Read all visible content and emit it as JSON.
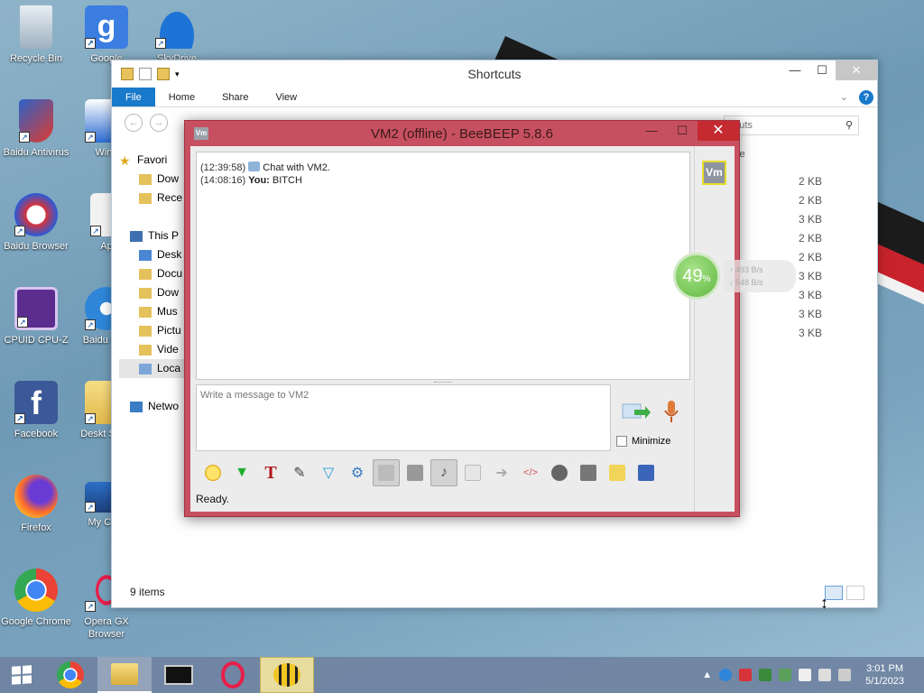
{
  "desktop": {
    "icons": [
      {
        "label": "Recycle Bin"
      },
      {
        "label": "Google"
      },
      {
        "label": "SkyDrive"
      },
      {
        "label": "Baidu Antivirus"
      },
      {
        "label": "WinL"
      },
      {
        "label": "Baidu Browser"
      },
      {
        "label": "Ap"
      },
      {
        "label": "CPUID CPU-Z"
      },
      {
        "label": "Baidu Fast"
      },
      {
        "label": "Facebook"
      },
      {
        "label": "Deskt Short"
      },
      {
        "label": "Firefox"
      },
      {
        "label": "My Com"
      },
      {
        "label": "Google Chrome"
      },
      {
        "label": "Opera GX Browser"
      }
    ]
  },
  "explorer": {
    "title": "Shortcuts",
    "ribbon_tabs": [
      "File",
      "Home",
      "Share",
      "View"
    ],
    "search_placeholder": "rtcuts",
    "nav": [
      {
        "label": "Favori"
      },
      {
        "label": "Dow"
      },
      {
        "label": "Rece"
      },
      {
        "label": "This P"
      },
      {
        "label": "Desk"
      },
      {
        "label": "Docu"
      },
      {
        "label": "Dow"
      },
      {
        "label": "Mus"
      },
      {
        "label": "Pictu"
      },
      {
        "label": "Vide"
      },
      {
        "label": "Loca"
      },
      {
        "label": "Netwo"
      }
    ],
    "size_header": "ze",
    "sizes": [
      "2 KB",
      "2 KB",
      "3 KB",
      "2 KB",
      "2 KB",
      "3 KB",
      "3 KB",
      "3 KB",
      "3 KB"
    ],
    "status": "9 items"
  },
  "beebeep": {
    "title": "VM2 (offline) - BeeBEEP 5.8.6",
    "app_icon_text": "Vm",
    "user_badge": "Vm",
    "messages": [
      {
        "time": "(12:39:58)",
        "sender": "",
        "text": "Chat with VM2."
      },
      {
        "time": "(14:08:16)",
        "sender": "You:",
        "text": "BITCH"
      }
    ],
    "input_placeholder": "Write a message to VM2",
    "minimize_label": "Minimize",
    "status": "Ready."
  },
  "network_widget": {
    "percent": "49",
    "percent_unit": "%",
    "upload": "493 B/s",
    "download": "548 B/s"
  },
  "taskbar": {
    "time": "3:01 PM",
    "date": "5/1/2023"
  },
  "colors": {
    "beebeep_frame": "#c75060",
    "explorer_file_tab": "#1979ca",
    "taskbar": "#6e82a0"
  }
}
